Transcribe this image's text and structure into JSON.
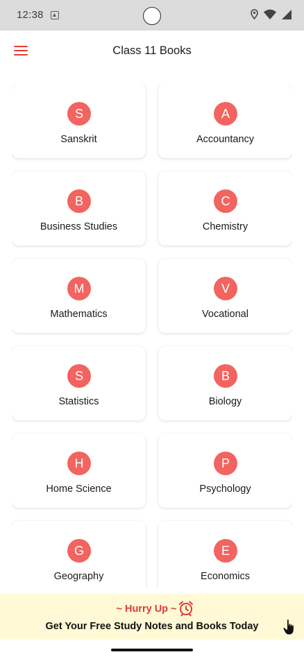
{
  "status_bar": {
    "time": "12:38",
    "icons": [
      "notification-a-icon",
      "location-icon",
      "wifi-icon",
      "signal-icon"
    ]
  },
  "app_bar": {
    "title": "Class 11 Books",
    "menu_icon": "hamburger-menu-icon",
    "accent_color": "#e53935"
  },
  "books": [
    {
      "letter": "S",
      "name": "Sanskrit"
    },
    {
      "letter": "A",
      "name": "Accountancy"
    },
    {
      "letter": "B",
      "name": "Business Studies"
    },
    {
      "letter": "C",
      "name": "Chemistry"
    },
    {
      "letter": "M",
      "name": "Mathematics"
    },
    {
      "letter": "V",
      "name": "Vocational"
    },
    {
      "letter": "S",
      "name": "Statistics"
    },
    {
      "letter": "B",
      "name": "Biology"
    },
    {
      "letter": "H",
      "name": "Home Science"
    },
    {
      "letter": "P",
      "name": "Psychology"
    },
    {
      "letter": "G",
      "name": "Geography"
    },
    {
      "letter": "E",
      "name": "Economics"
    }
  ],
  "avatar_color": "#f26460",
  "banner": {
    "hurry": "~ Hurry Up ~",
    "promo": "Get Your Free Study Notes and Books Today",
    "background": "#fff9d6",
    "icons": [
      "alarm-clock-icon",
      "tap-hand-icon"
    ]
  }
}
